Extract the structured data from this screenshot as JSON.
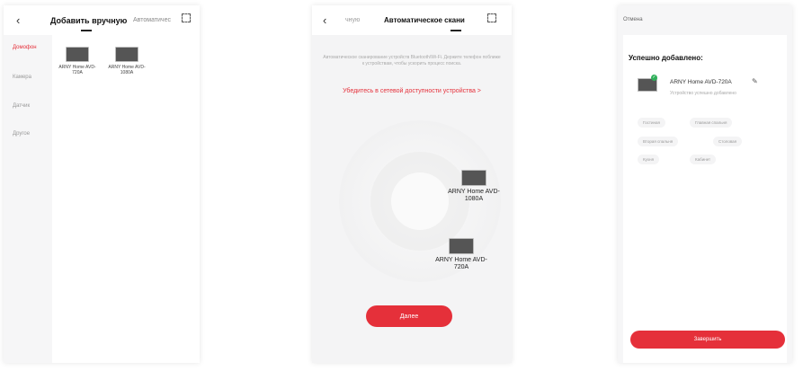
{
  "screen1": {
    "back_icon": "chevron-left-icon",
    "tab_manual": "Добавить вручную",
    "tab_auto": "Автоматичес",
    "scan_icon": "scan-icon",
    "categories": [
      "Домофон",
      "Камера",
      "Датчик",
      "Другое"
    ],
    "devices": [
      {
        "name": "ARNY Home AVD-720A"
      },
      {
        "name": "ARNY Home AVD-1080A"
      }
    ]
  },
  "screen2": {
    "back_icon": "chevron-left-icon",
    "tab_manual": "чную",
    "tab_auto": "Автоматическое скани",
    "scan_icon": "scan-icon",
    "hint": "Автоматическое сканирование устройств Bluetooth/Wi-Fi. Держите телефон поближе к устройствам, чтобы ускорить процесс поиска.",
    "warning": "Убедитесь в сетевой доступности устройства  >",
    "devices": [
      {
        "name": "ARNY Home AVD-1080A"
      },
      {
        "name": "ARNY Home AVD-720A"
      }
    ],
    "next_button": "Далее"
  },
  "screen3": {
    "cancel": "Отмена",
    "title": "Успешно добавлено:",
    "device_name": "ARNY Home AVD-720A",
    "device_sub": "Устройство успешно добавлено",
    "edit_icon": "pencil-icon",
    "rooms": [
      "Гостиная",
      "Главная спальня",
      "Вторая спальня",
      "Столовая",
      "Кухня",
      "Кабинет"
    ],
    "finish_button": "Завершить"
  },
  "colors": {
    "accent": "#e5303a",
    "success": "#2fb05a",
    "background": "#f6f6f7"
  }
}
